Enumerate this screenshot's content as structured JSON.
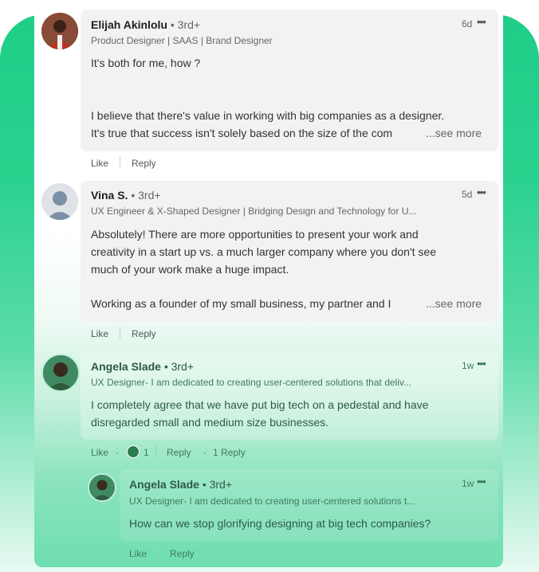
{
  "comments": [
    {
      "author": "Elijah Akinlolu",
      "degree": "• 3rd+",
      "headline": "Product Designer | SAAS | Brand Designer",
      "time": "6d",
      "lines": [
        "It's both for me, how ?",
        "",
        "",
        "I believe that there's value in working with big companies as a designer.",
        "It's true that success isn't solely based on the size of the com"
      ],
      "see_more": "...see more",
      "like": "Like",
      "reply": "Reply"
    },
    {
      "author": "Vina S.",
      "degree": "• 3rd+",
      "headline": "UX Engineer & X-Shaped Designer | Bridging Design and Technology for U...",
      "time": "5d",
      "lines": [
        "Absolutely! There are more opportunities to present your work and",
        "creativity in a start up vs. a much larger company where you don't see",
        "much of your work make a huge impact.",
        "",
        "Working as a founder of my small business, my partner and I"
      ],
      "see_more": "...see more",
      "like": "Like",
      "reply": "Reply"
    },
    {
      "author": "Angela Slade",
      "degree": "• 3rd+",
      "headline": "UX Designer- I am dedicated to creating user-centered solutions that deliv...",
      "time": "1w",
      "lines": [
        "I completely agree that we have put big tech on a pedestal and have",
        "disregarded small and medium size businesses."
      ],
      "like": "Like",
      "reaction_count": "1",
      "reply": "Reply",
      "replies": "1 Reply"
    },
    {
      "author": "Angela Slade",
      "degree": "• 3rd+",
      "headline": "UX Designer- I am dedicated to creating user-centered solutions t...",
      "time": "1w",
      "lines": [
        "How can we stop glorifying designing at big tech companies?"
      ],
      "like": "Like",
      "reply": "Reply"
    }
  ],
  "colors": {
    "brand_green": "#1fce87",
    "bubble_gray": "#f2f2f2",
    "reaction_green": "#2e7d4f"
  },
  "icons": [
    "more-options-icon",
    "celebrate-reaction-icon"
  ]
}
